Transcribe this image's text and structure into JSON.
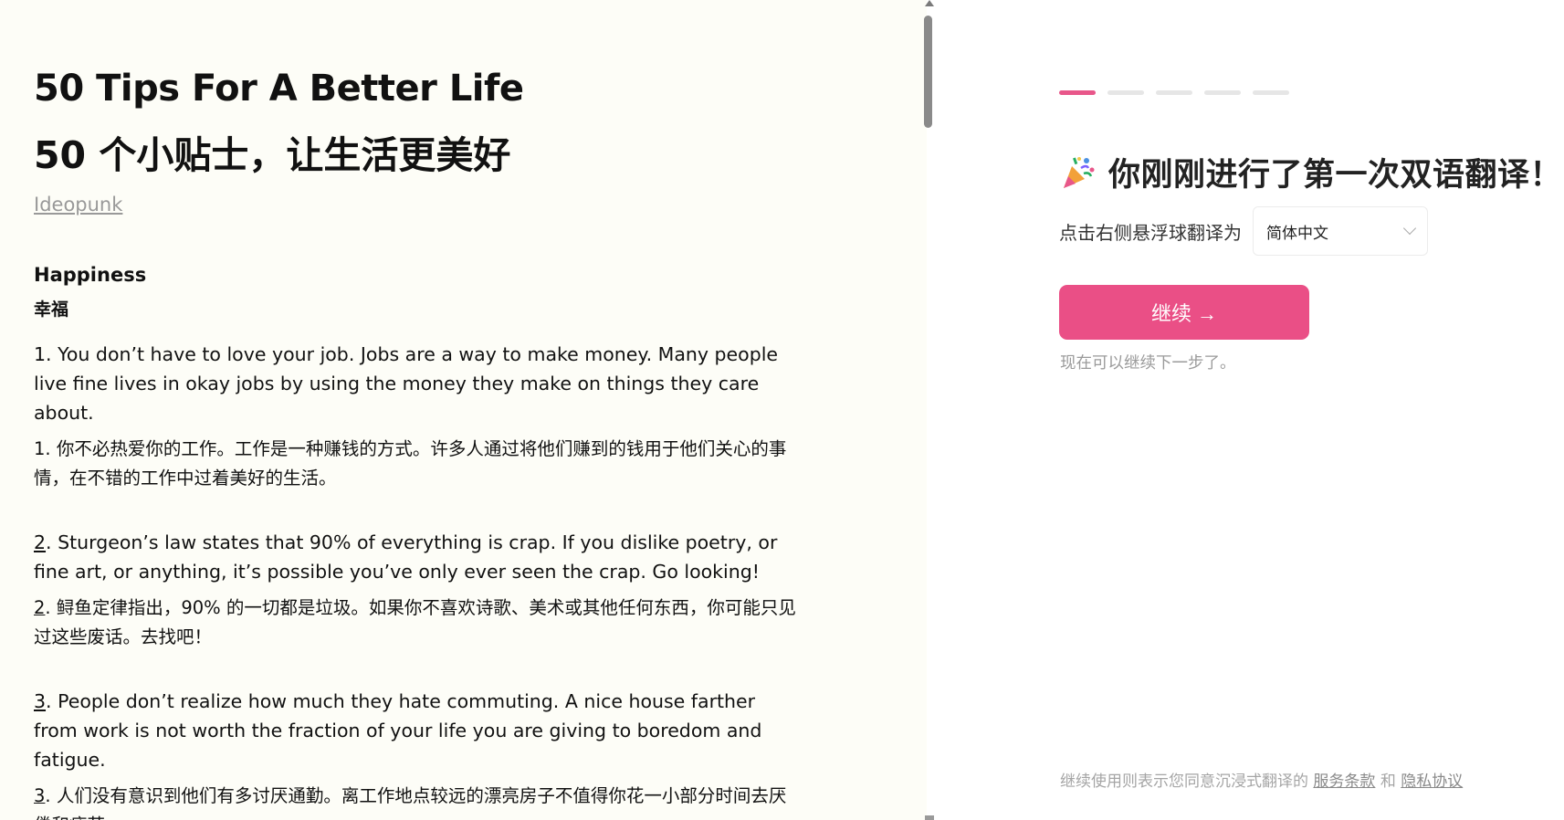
{
  "article": {
    "title_en": "50 Tips For A Better Life",
    "title_zh": "50 个小贴士，让生活更美好",
    "author": "Ideopunk",
    "section_en": "Happiness",
    "section_zh": "幸福",
    "tips": [
      {
        "num": "1",
        "en": ". You don’t have to love your job. Jobs are a way to make money. Many people live fine lives in okay jobs by using the money they make on things they care about.",
        "zh": ". 你不必热爱你的工作。工作是一种赚钱的方式。许多人通过将他们赚到的钱用于他们关心的事情，在不错的工作中过着美好的生活。"
      },
      {
        "num": "2",
        "en": ". Sturgeon’s law states that 90% of everything is crap. If you dislike poetry, or fine art, or anything, it’s possible you’ve only ever seen the crap. Go looking!",
        "zh": ". 鲟鱼定律指出，90% 的一切都是垃圾。如果你不喜欢诗歌、美术或其他任何东西，你可能只见过这些废话。去找吧！"
      },
      {
        "num": "3",
        "en": ". People don’t realize how much they hate commuting. A nice house farther from work is not worth the fraction of your life you are giving to boredom and fatigue.",
        "zh": ". 人们没有意识到他们有多讨厌通勤。离工作地点较远的漂亮房子不值得你花一小部分时间去厌倦和疲劳。"
      }
    ]
  },
  "onboarding": {
    "steps_total": 5,
    "active_step": 1,
    "accent_color": "#ea4f86",
    "party_icon": "party-popper-icon",
    "heading": "你刚刚进行了第一次双语翻译！",
    "lang_label": "点击右侧悬浮球翻译为",
    "lang_selected": "简体中文",
    "continue_label": "继续 →",
    "hint": "现在可以继续下一步了。",
    "footer_prefix": "继续使用则表示您同意沉浸式翻译的",
    "terms_link": "服务条款",
    "footer_and": "和",
    "privacy_link": "隐私协议"
  }
}
